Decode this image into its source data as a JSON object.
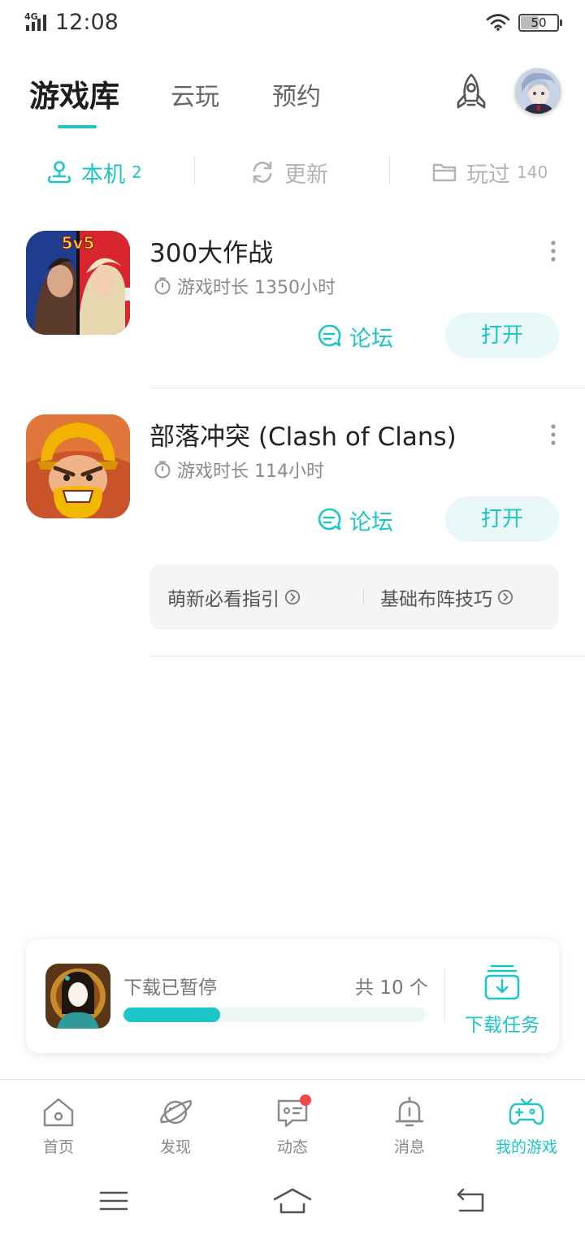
{
  "status_bar": {
    "network": "4G",
    "time": "12:08",
    "battery": "50"
  },
  "header": {
    "tabs": [
      {
        "label": "游戏库",
        "active": true
      },
      {
        "label": "云玩",
        "active": false
      },
      {
        "label": "预约",
        "active": false
      }
    ],
    "rocket_icon": "rocket-icon",
    "avatar_icon": "user-avatar"
  },
  "sub_tabs": [
    {
      "label": "本机",
      "count": "2",
      "icon": "device-user-icon",
      "active": true
    },
    {
      "label": "更新",
      "count": "",
      "icon": "refresh-icon",
      "active": false
    },
    {
      "label": "玩过",
      "count": "140",
      "icon": "folder-icon",
      "active": false
    }
  ],
  "games": [
    {
      "title": "300大作战",
      "play_time": "游戏时长 1350小时",
      "icon_text": "5v5",
      "forum_label": "论坛",
      "open_label": "打开"
    },
    {
      "title": "部落冲突 (Clash of Clans)",
      "play_time": "游戏时长 114小时",
      "forum_label": "论坛",
      "open_label": "打开",
      "guides": [
        "萌新必看指引",
        "基础布阵技巧"
      ]
    }
  ],
  "download": {
    "status": "下载已暂停",
    "total": "共 10 个",
    "progress": 0.32,
    "task_label": "下载任务"
  },
  "bottom_nav": [
    {
      "label": "首页",
      "icon": "home-icon",
      "active": false
    },
    {
      "label": "发现",
      "icon": "planet-icon",
      "active": false
    },
    {
      "label": "动态",
      "icon": "chat-icon",
      "active": false,
      "badge": true
    },
    {
      "label": "消息",
      "icon": "bell-icon",
      "active": false
    },
    {
      "label": "我的游戏",
      "icon": "gamepad-icon",
      "active": true
    }
  ],
  "colors": {
    "accent": "#1ec5c8",
    "badge": "#f04848",
    "text_primary": "#222222",
    "text_secondary": "#8a8a8a"
  }
}
